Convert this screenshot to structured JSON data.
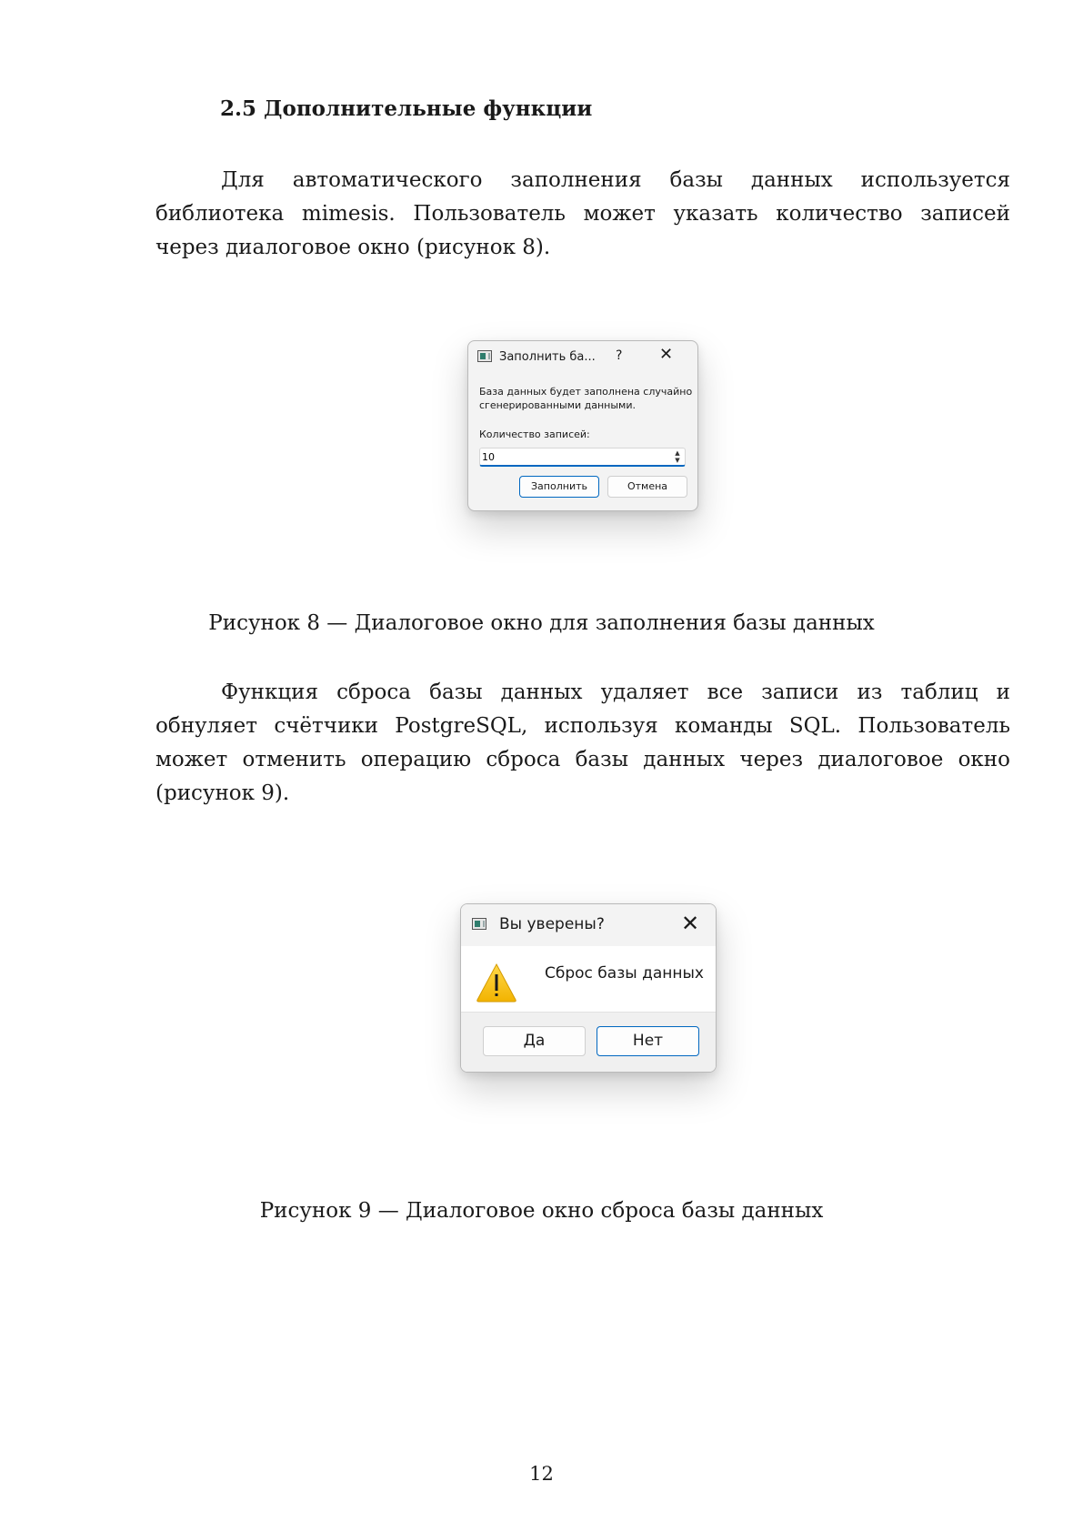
{
  "heading": "2.5 Дополнительные функции",
  "paragraph1": "Для автоматического заполнения базы данных используется библиотека mimesis. Пользователь может указать количество записей через диалоговое окно (рисунок 8).",
  "dialog1": {
    "title": "Заполнить ба...",
    "help_glyph": "?",
    "close_glyph": "✕",
    "message": "База данных будет заполнена случайно сгенерированными данными.",
    "count_label": "Количество записей:",
    "count_value": "10",
    "fill_button": "Заполнить",
    "cancel_button": "Отмена"
  },
  "caption1": "Рисунок 8 — Диалоговое окно для заполнения базы данных",
  "paragraph2": "Функция сброса базы данных удаляет все записи из таблиц и обнуляет счётчики PostgreSQL, используя команды SQL. Пользователь может отменить операцию сброса базы данных через диалоговое окно (рисунок 9).",
  "dialog2": {
    "title": "Вы уверены?",
    "close_glyph": "✕",
    "icon": "warning-icon",
    "message": "Сброс базы данных",
    "yes_button": "Да",
    "no_button": "Нет"
  },
  "caption2": "Рисунок 9 — Диалоговое окно сброса базы данных",
  "page_number": "12"
}
